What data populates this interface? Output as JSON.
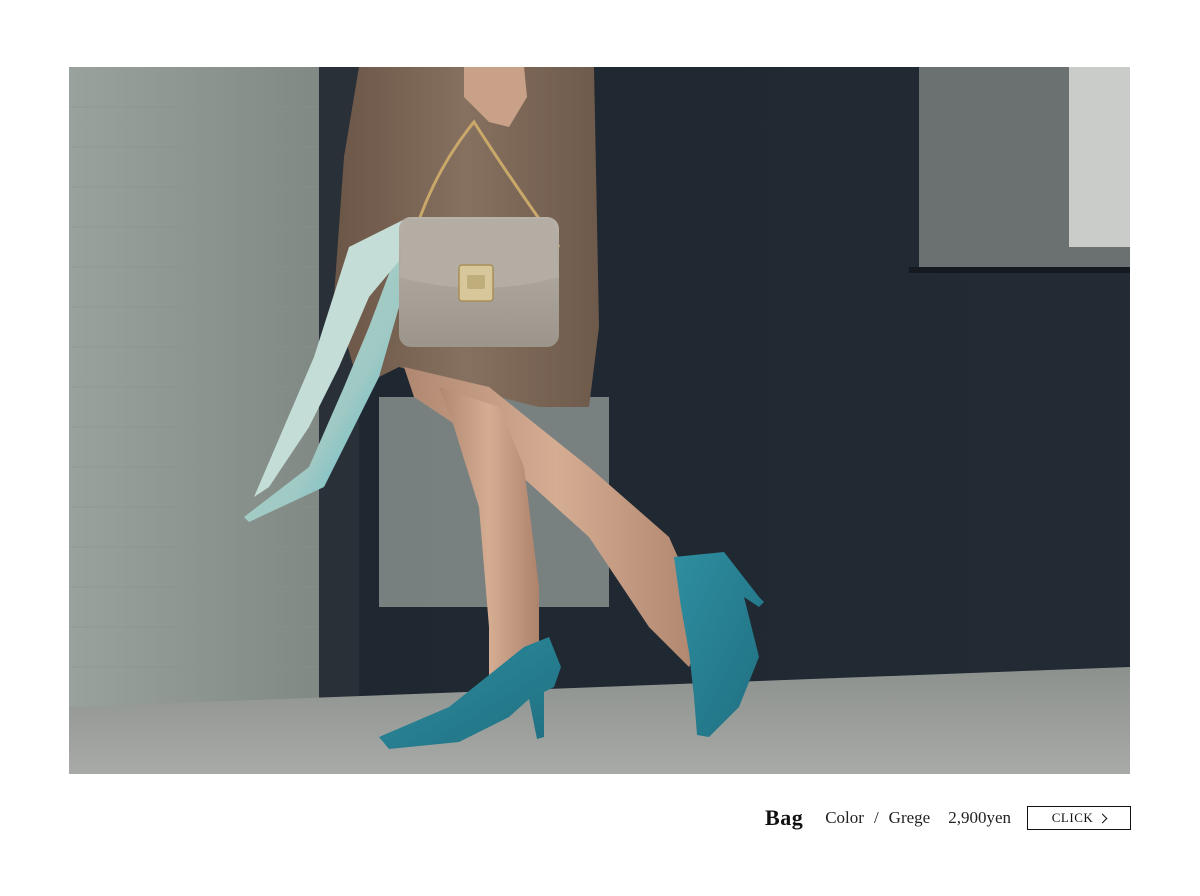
{
  "photo": {
    "subject": "fashion-photo"
  },
  "caption": {
    "product_name": "Bag",
    "color_label": "Color",
    "separator": "/",
    "color_value": "Grege",
    "price": "2,900yen",
    "button_label": "CLICK"
  },
  "colors": {
    "background": "#ffffff",
    "button_border": "#111111",
    "text": "#111111"
  }
}
